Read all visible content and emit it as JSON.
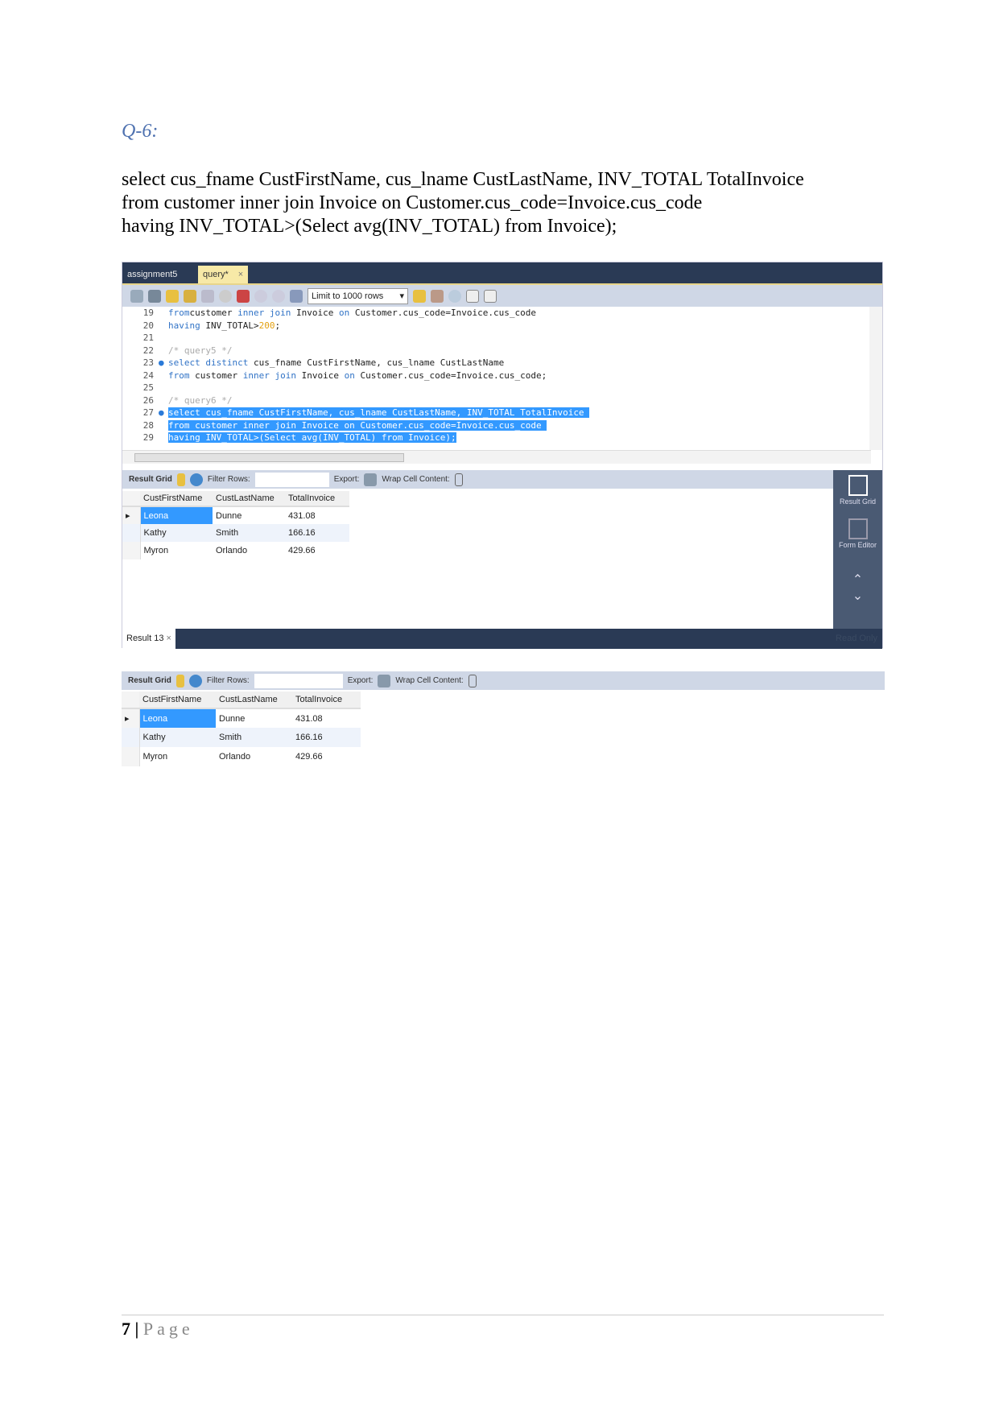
{
  "question": "Q-6:",
  "sql_lines": [
    "select cus_fname CustFirstName, cus_lname CustLastName, INV_TOTAL TotalInvoice",
    "from customer inner join Invoice on Customer.cus_code=Invoice.cus_code",
    "having INV_TOTAL>(Select avg(INV_TOTAL) from Invoice);"
  ],
  "workbench": {
    "tabs": [
      {
        "label": "assignment5"
      },
      {
        "label": "query*",
        "close": "×"
      }
    ],
    "limit_select": "Limit to 1000 rows",
    "editor_lines": [
      {
        "n": "19",
        "code": [
          [
            "kw",
            "from"
          ],
          [
            "",
            "customer "
          ],
          [
            "kw",
            "inner join"
          ],
          [
            "",
            " Invoice "
          ],
          [
            "kw",
            "on"
          ],
          [
            "",
            " Customer.cus_code=Invoice.cus_code"
          ]
        ]
      },
      {
        "n": "20",
        "code": [
          [
            "kw",
            "having"
          ],
          [
            "",
            " INV_TOTAL>"
          ],
          [
            "num",
            "200"
          ],
          [
            "",
            ";"
          ]
        ]
      },
      {
        "n": "21",
        "code": []
      },
      {
        "n": "22",
        "code": [
          [
            "cm",
            "/* query5 */"
          ]
        ]
      },
      {
        "n": "23",
        "dot": true,
        "code": [
          [
            "kw",
            "select distinct"
          ],
          [
            "",
            " cus_fname CustFirstName, cus_lname CustLastName"
          ]
        ]
      },
      {
        "n": "24",
        "code": [
          [
            "kw",
            "from"
          ],
          [
            "",
            " customer "
          ],
          [
            "kw",
            "inner join"
          ],
          [
            "",
            " Invoice "
          ],
          [
            "kw",
            "on"
          ],
          [
            "",
            " Customer.cus_code=Invoice.cus_code;"
          ]
        ]
      },
      {
        "n": "25",
        "code": []
      },
      {
        "n": "26",
        "code": [
          [
            "cm",
            "/* query6 */"
          ]
        ]
      },
      {
        "n": "27",
        "dot": true,
        "sel": true,
        "code": [
          [
            "",
            "select cus_fname CustFirstName, cus_lname CustLastName, INV_TOTAL TotalInvoice "
          ]
        ]
      },
      {
        "n": "28",
        "sel": true,
        "code": [
          [
            "",
            "from customer inner join Invoice on Customer.cus_code=Invoice.cus_code "
          ]
        ]
      },
      {
        "n": "29",
        "sel": true,
        "code": [
          [
            "",
            "having INV_TOTAL>(Select avg(INV_TOTAL) from Invoice);"
          ]
        ]
      }
    ],
    "result_toolbar": {
      "result_grid": "Result Grid",
      "filter_rows": "Filter Rows:",
      "export": "Export:",
      "wrap": "Wrap Cell Content:"
    },
    "side": {
      "result_grid": "Result Grid",
      "form_editor": "Form Editor"
    },
    "result_tab": "Result 13",
    "read_only": "Read Only"
  },
  "grid": {
    "columns": [
      "CustFirstName",
      "CustLastName",
      "TotalInvoice"
    ],
    "rows": [
      [
        "Leona",
        "Dunne",
        "431.08"
      ],
      [
        "Kathy",
        "Smith",
        "166.16"
      ],
      [
        "Myron",
        "Orlando",
        "429.66"
      ]
    ]
  },
  "footer": {
    "page_number": "7",
    "separator": "|",
    "page_label": "Page"
  }
}
